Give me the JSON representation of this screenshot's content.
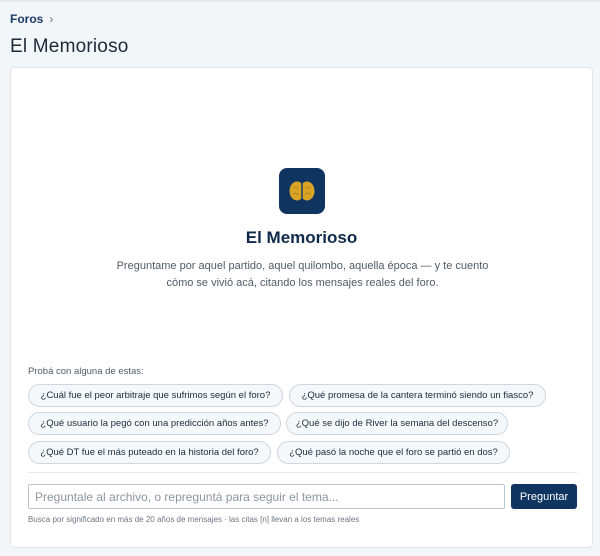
{
  "breadcrumb": {
    "root": "Foros",
    "separator": "›"
  },
  "page": {
    "title": "El Memorioso"
  },
  "hero": {
    "icon": "brain-icon",
    "title": "El Memorioso",
    "description": "Preguntame por aquel partido, aquel quilombo, aquella época — y te cuento cómo se vivió acá, citando los mensajes reales del foro."
  },
  "suggestions": {
    "label": "Probá con alguna de estas:",
    "items": [
      "¿Cuál fue el peor arbitraje que sufrimos según el foro?",
      "¿Qué promesa de la cantera terminó siendo un fiasco?",
      "¿Qué usuario la pegó con una predicción años antes?",
      "¿Qué se dijo de River la semana del descenso?",
      "¿Qué DT fue el más puteado en la historia del foro?",
      "¿Qué pasó la noche que el foro se partió en dos?"
    ]
  },
  "composer": {
    "placeholder": "Preguntale al archivo, o repreguntá para seguir el tema...",
    "value": "",
    "button_label": "Preguntar",
    "hint": "Busca por significado en más de 20 años de mensajes · las citas [n] llevan a los temas reales"
  },
  "colors": {
    "accent": "#0f3460",
    "brain": "#d9a426",
    "background": "#f3f6f9"
  }
}
